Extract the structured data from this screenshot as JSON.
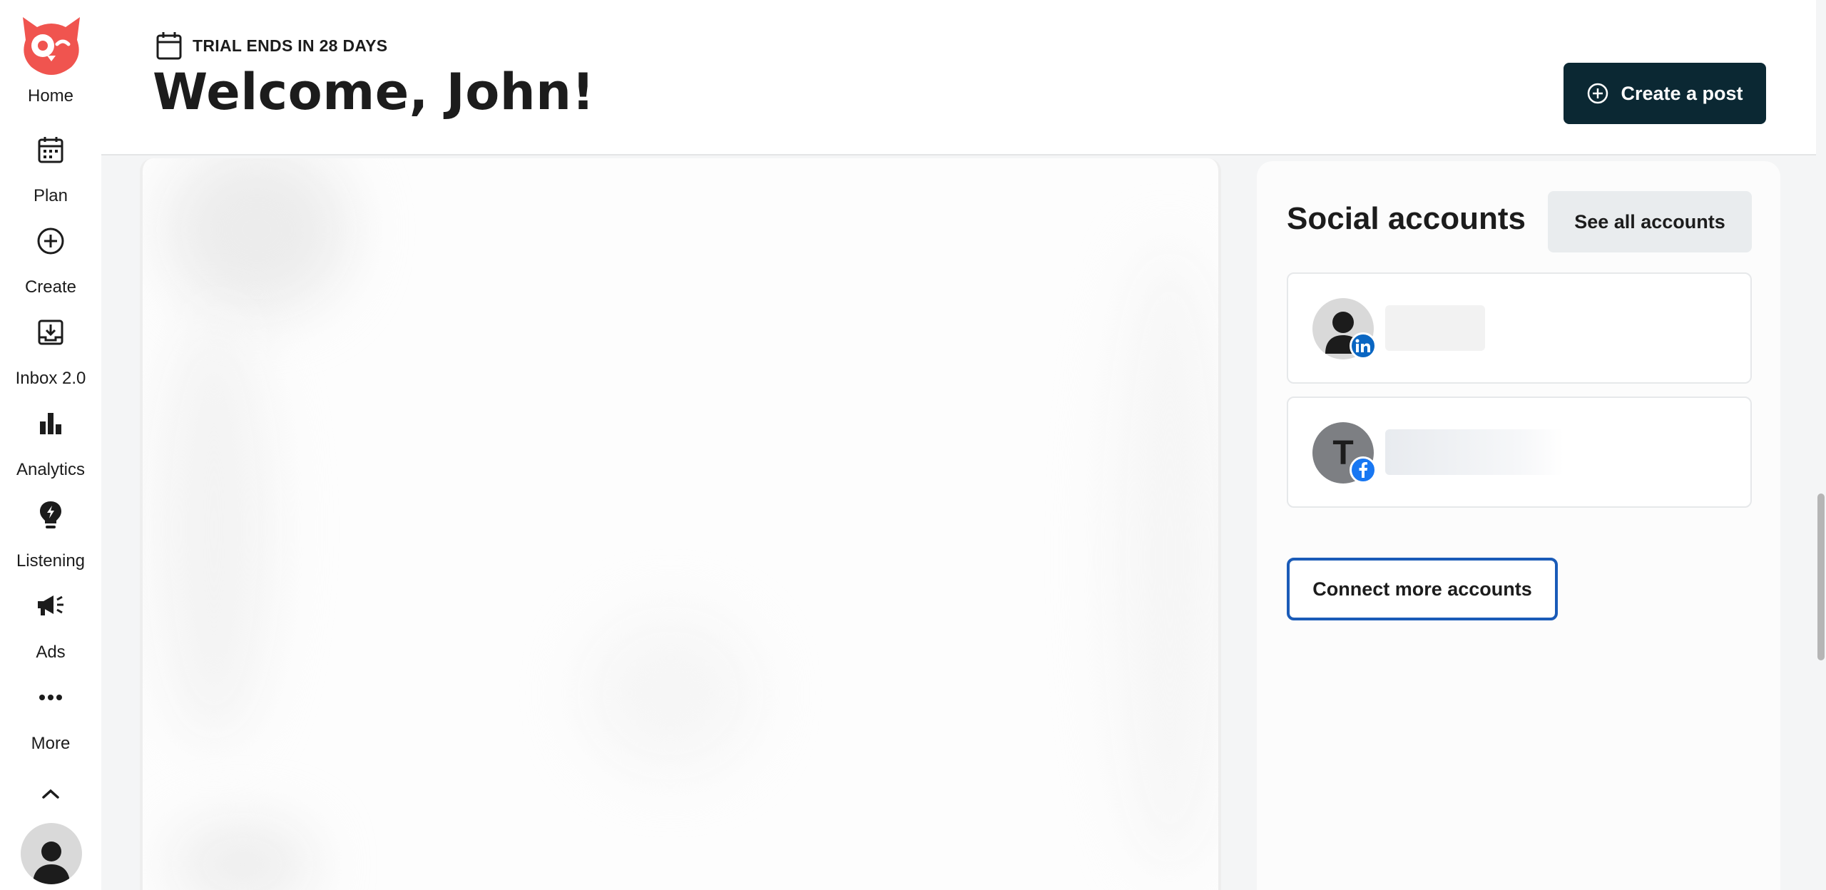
{
  "sidebar": {
    "items": [
      {
        "label": "Home",
        "icon": "owl-logo-icon"
      },
      {
        "label": "Plan",
        "icon": "calendar-icon"
      },
      {
        "label": "Create",
        "icon": "plus-circle-icon"
      },
      {
        "label": "Inbox 2.0",
        "icon": "inbox-icon"
      },
      {
        "label": "Analytics",
        "icon": "bar-chart-icon"
      },
      {
        "label": "Listening",
        "icon": "lightbulb-icon"
      },
      {
        "label": "Ads",
        "icon": "megaphone-icon"
      },
      {
        "label": "More",
        "icon": "more-dots-icon"
      }
    ]
  },
  "header": {
    "trial_text": "TRIAL ENDS IN 28 DAYS",
    "welcome": "Welcome, John!",
    "create_post_label": "Create a post"
  },
  "social_accounts": {
    "title": "Social accounts",
    "see_all_label": "See all accounts",
    "accounts": [
      {
        "network": "linkedin",
        "avatar_type": "default-person",
        "badge_color": "#0a66c2"
      },
      {
        "network": "facebook",
        "avatar_initial": "T",
        "badge_color": "#1877f2"
      }
    ],
    "connect_label": "Connect more accounts"
  },
  "colors": {
    "brand_red": "#f0544f",
    "primary_dark": "#0b2833",
    "focus_blue": "#1a5bb8"
  }
}
